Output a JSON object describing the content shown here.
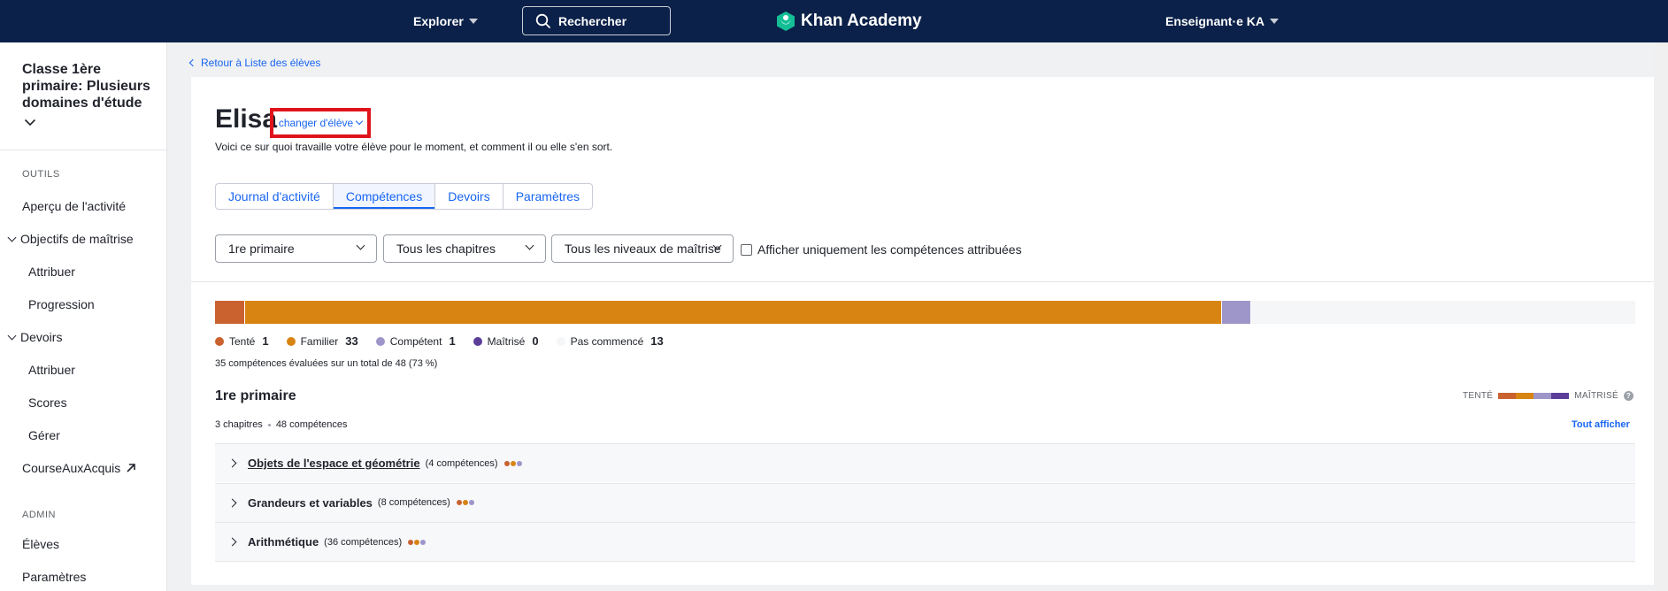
{
  "topbar": {
    "explore_label": "Explorer",
    "search_label": "Rechercher",
    "logo_text": "Khan Academy",
    "user_label": "Enseignant·e KA"
  },
  "sidebar": {
    "class_title": "Classe 1ère primaire: Plusieurs domaines d'étude",
    "tools_heading": "OUTILS",
    "items": [
      {
        "label": "Aperçu de l'activité"
      },
      {
        "label": "Objectifs de maîtrise"
      },
      {
        "label": "Attribuer"
      },
      {
        "label": "Progression"
      },
      {
        "label": "Devoirs"
      },
      {
        "label": "Attribuer"
      },
      {
        "label": "Scores"
      },
      {
        "label": "Gérer"
      },
      {
        "label": "CourseAuxAcquis"
      }
    ],
    "admin_heading": "ADMIN",
    "admin_items": [
      {
        "label": "Élèves"
      },
      {
        "label": "Paramètres"
      }
    ]
  },
  "main": {
    "breadcrumb": "Retour à Liste des élèves",
    "student_name": "Elisa",
    "change_student": "changer d'élève",
    "subtitle": "Voici ce sur quoi travaille votre élève pour le moment, et comment il ou elle s'en sort.",
    "tabs": [
      {
        "label": "Journal d'activité"
      },
      {
        "label": "Compétences"
      },
      {
        "label": "Devoirs"
      },
      {
        "label": "Paramètres"
      }
    ],
    "filters": {
      "grade": "1re primaire",
      "chapters": "Tous les chapitres",
      "levels": "Tous les niveaux de maîtrise",
      "checkbox_label": "Afficher uniquement les compétences attribuées"
    },
    "progress": {
      "total": 48,
      "segments": [
        {
          "label": "Tenté",
          "count": 1,
          "color": "#c9622f"
        },
        {
          "label": "Familier",
          "count": 33,
          "color": "#d88413"
        },
        {
          "label": "Compétent",
          "count": 1,
          "color": "#9e96c9"
        },
        {
          "label": "Maîtrisé",
          "count": 0,
          "color": "#5a3e98"
        },
        {
          "label": "Pas commencé",
          "count": 13,
          "color": "#f5f6f8"
        }
      ]
    },
    "summary": "35 compétences évaluées sur un total de 48 (73 %)",
    "grade_title": "1re primaire",
    "chapters_meta": "3 chapitres",
    "skills_meta": "48 compétences",
    "scale": {
      "low": "TENTÉ",
      "high": "MAÎTRISÉ",
      "colors": [
        "#c9622f",
        "#d88413",
        "#9e96c9",
        "#5a3e98"
      ]
    },
    "show_all": "Tout afficher",
    "chapter_rows": [
      {
        "name": "Objets de l'espace et géométrie",
        "count": "(4 compétences)",
        "dots": [
          "#c9622f",
          "#d88413",
          "#9e96c9"
        ]
      },
      {
        "name": "Grandeurs et variables",
        "count": "(8 compétences)",
        "dots": [
          "#c9622f",
          "#d88413",
          "#9e96c9"
        ]
      },
      {
        "name": "Arithmétique",
        "count": "(36 compétences)",
        "dots": [
          "#c9622f",
          "#d88413",
          "#9e96c9"
        ]
      }
    ]
  }
}
